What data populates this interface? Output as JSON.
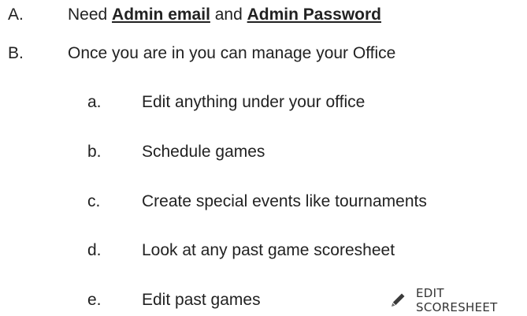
{
  "items": [
    {
      "marker": "A.",
      "prefix": "Need ",
      "emph1": "Admin email",
      "middle": " and ",
      "emph2": "Admin Password"
    },
    {
      "marker": "B.",
      "text": "Once you are in you can manage your Office"
    }
  ],
  "subitems": [
    {
      "marker": "a.",
      "text": "Edit anything under your office"
    },
    {
      "marker": "b.",
      "text": "Schedule games"
    },
    {
      "marker": "c.",
      "text": "Create special events like tournaments"
    },
    {
      "marker": "d.",
      "text": "Look at any past game scoresheet"
    },
    {
      "marker": "e.",
      "text": "Edit past games"
    }
  ],
  "edit_button": {
    "icon": "pencil-icon",
    "label": "EDIT SCORESHEET"
  }
}
